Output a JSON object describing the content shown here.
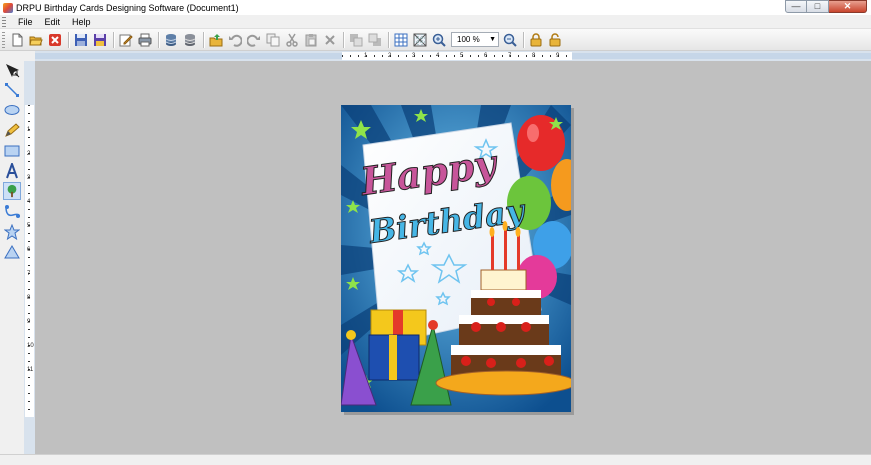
{
  "window": {
    "title": "DRPU Birthday Cards Designing Software  (Document1)"
  },
  "menu": {
    "items": [
      "File",
      "Edit",
      "Help"
    ]
  },
  "toolbar": {
    "zoom_value": "100 %"
  },
  "ruler": {
    "h_numbers": [
      "1",
      "2",
      "3",
      "4",
      "5",
      "6",
      "7",
      "8",
      "9"
    ],
    "v_numbers": [
      "1",
      "2",
      "3",
      "4",
      "5",
      "6",
      "7",
      "8",
      "9",
      "10",
      "11"
    ]
  },
  "card": {
    "line1": "Happy",
    "line2": "Birthday"
  },
  "colors": {
    "canvas": "#c0c0c0",
    "card_background": "#1c6fb4",
    "accent": "#3a7bd5"
  }
}
